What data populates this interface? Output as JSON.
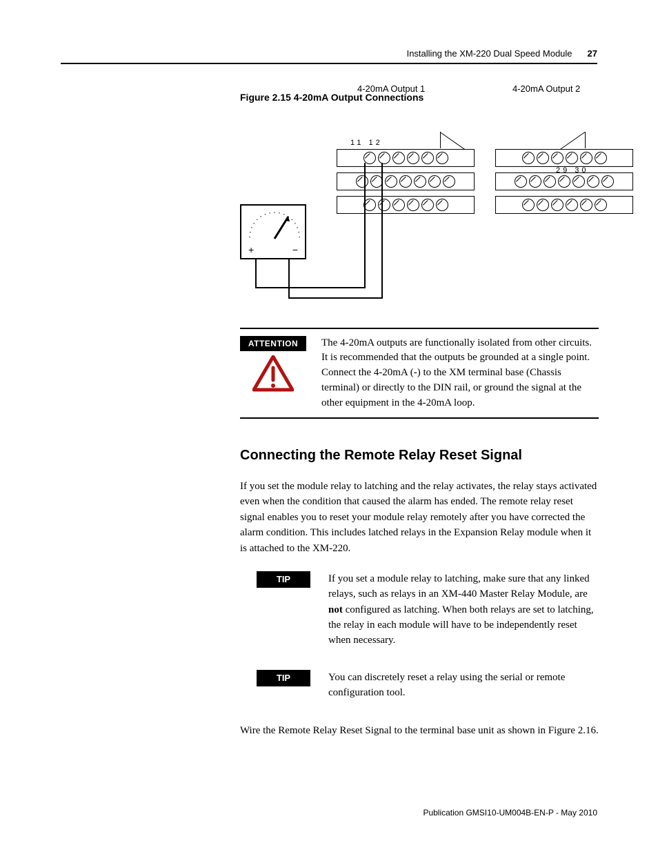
{
  "header": {
    "section_title": "Installing the XM-220 Dual Speed Module",
    "page_number": "27"
  },
  "figure": {
    "caption": "Figure 2.15 4-20mA Output Connections",
    "output1_label": "4-20mA Output 1",
    "output2_label": "4-20mA Output 2",
    "terminals_left": "11  12",
    "terminals_right": "29  30",
    "meter_plus": "+",
    "meter_minus": "−"
  },
  "attention": {
    "label": "ATTENTION",
    "text": "The 4-20mA outputs are functionally isolated from other circuits. It is recommended that the outputs be grounded at a single point. Connect the 4-20mA (-) to the XM terminal base (Chassis terminal) or directly to the DIN rail, or ground the signal at the other equipment in the 4-20mA loop."
  },
  "section_heading": "Connecting the Remote Relay Reset Signal",
  "para1": "If you set the module relay to latching and the relay activates, the relay stays activated even when the condition that caused the alarm has ended. The remote relay reset signal enables you to reset your module relay remotely after you have corrected the alarm condition. This includes latched relays in the Expansion Relay module when it is attached to the XM-220.",
  "tip1": {
    "label": "TIP",
    "pre": "If you set a module relay to latching, make sure that any linked relays, such as relays in an XM-440 Master Relay Module, are ",
    "bold": "not",
    "post": " configured as latching. When both relays are set to latching, the relay in each module will have to be independently reset when necessary."
  },
  "tip2": {
    "label": "TIP",
    "text": "You can discretely reset a relay using the serial or remote configuration tool."
  },
  "para2": "Wire the Remote Relay Reset Signal to the terminal base unit as shown in Figure 2.16.",
  "footer": "Publication GMSI10-UM004B-EN-P - May 2010"
}
